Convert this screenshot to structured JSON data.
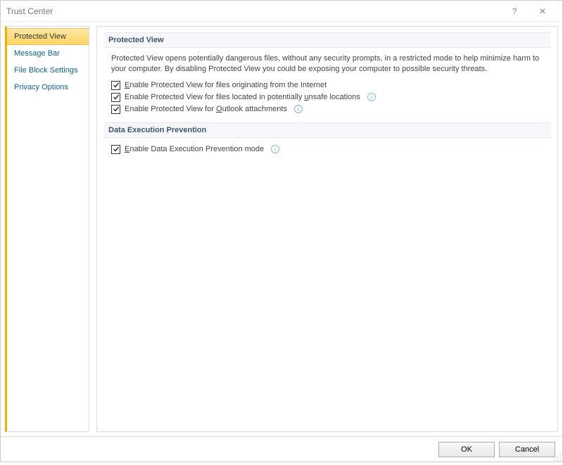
{
  "titlebar": {
    "title": "Trust Center",
    "help": "?",
    "close": "✕"
  },
  "sidebar": {
    "items": [
      {
        "label": "Protected View",
        "active": true
      },
      {
        "label": "Message Bar",
        "active": false
      },
      {
        "label": "File Block Settings",
        "active": false
      },
      {
        "label": "Privacy Options",
        "active": false
      }
    ]
  },
  "content": {
    "section1": {
      "title": "Protected View",
      "desc": "Protected View opens potentially dangerous files, without any security prompts, in a restricted mode to help minimize harm to your computer. By disabling Protected View you could be exposing your computer to possible security threats.",
      "checks": [
        {
          "pre": "",
          "m": "E",
          "post": "nable Protected View for files originating from the Internet",
          "checked": true,
          "info": false
        },
        {
          "pre": "Enable Protected View for files located in potentially ",
          "m": "u",
          "post": "nsafe locations",
          "checked": true,
          "info": true
        },
        {
          "pre": "Enable Protected View for ",
          "m": "O",
          "post": "utlook attachments",
          "checked": true,
          "info": true
        }
      ]
    },
    "section2": {
      "title": "Data Execution Prevention",
      "checks": [
        {
          "pre": "",
          "m": "E",
          "post": "nable Data Execution Prevention mode",
          "checked": true,
          "info": true
        }
      ]
    }
  },
  "footer": {
    "ok": "OK",
    "cancel": "Cancel"
  }
}
